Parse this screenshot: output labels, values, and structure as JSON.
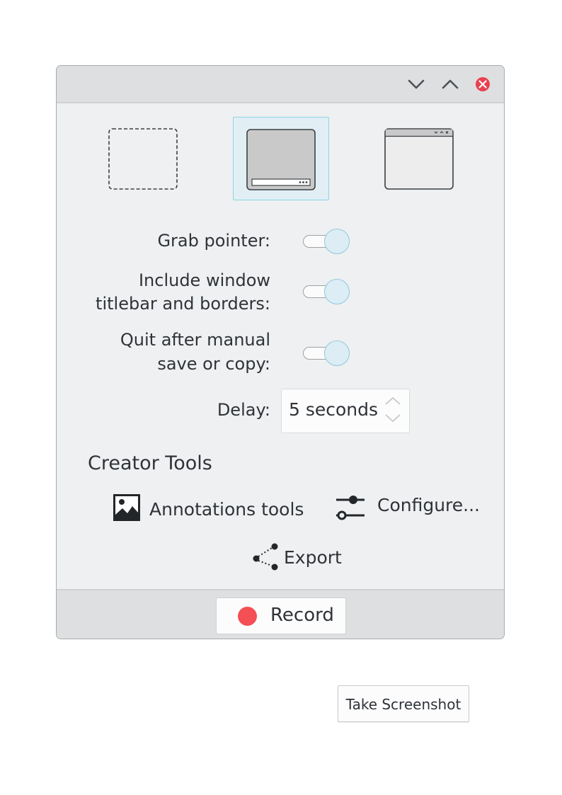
{
  "colors": {
    "window_bg": "#eff0f1",
    "titlebar_bg": "#dedfe0",
    "accent": "#8fd3e6",
    "selected_bg": "#e1eff5",
    "close_red": "#e9414f",
    "record_red": "#f44f55",
    "text": "#2f3338"
  },
  "titlebar": {
    "buttons": [
      {
        "icon": "chevron-down-icon"
      },
      {
        "icon": "chevron-up-icon"
      },
      {
        "icon": "close-icon"
      }
    ]
  },
  "capture_modes": [
    {
      "icon": "rectangular-region-icon",
      "selected": false
    },
    {
      "icon": "full-screen-icon",
      "selected": true
    },
    {
      "icon": "active-window-icon",
      "selected": false
    }
  ],
  "options": {
    "grab_pointer": {
      "label": "Grab pointer:",
      "enabled": true
    },
    "include_titlebar": {
      "label_line1": "Include window",
      "label_line2": "titlebar and borders:",
      "enabled": true
    },
    "quit_after": {
      "label_line1": "Quit after manual",
      "label_line2": "save or copy:",
      "enabled": true
    }
  },
  "delay": {
    "label": "Delay:",
    "value": "5 seconds"
  },
  "creator_tools": {
    "title": "Creator Tools",
    "annotations": {
      "label": "Annotations tools",
      "icon": "image-icon"
    },
    "configure": {
      "label": "Configure...",
      "icon": "sliders-icon"
    },
    "export": {
      "label": "Export",
      "icon": "share-icon"
    }
  },
  "footer": {
    "record_label": "Record"
  },
  "take_screenshot_label": "Take Screenshot"
}
